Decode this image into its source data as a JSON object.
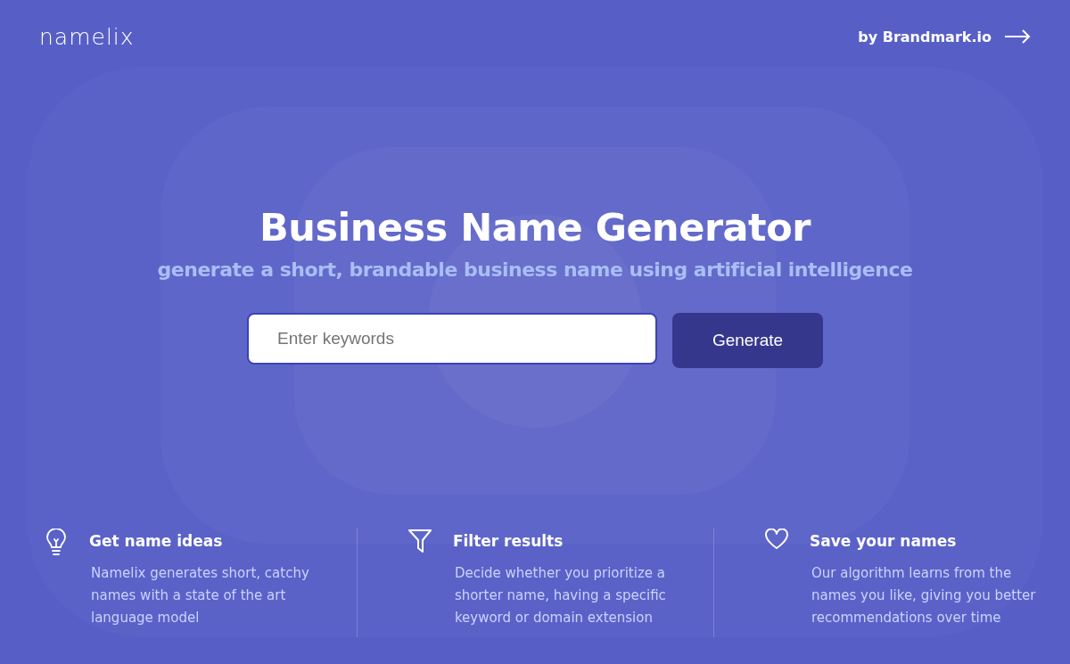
{
  "header": {
    "logo": "namelix",
    "link": "by Brandmark.io"
  },
  "hero": {
    "title": "Business Name Generator",
    "subtitle": "generate a short, brandable business name using artificial intelligence"
  },
  "search": {
    "placeholder": "Enter keywords",
    "button": "Generate"
  },
  "features": [
    {
      "kind": "bulb",
      "title": "Get name ideas",
      "text": "Namelix generates short, catchy names with a state of the art language model"
    },
    {
      "kind": "filter",
      "title": "Filter results",
      "text": "Decide whether you prioritize a shorter name, having a specific keyword or domain extension"
    },
    {
      "kind": "heart",
      "title": "Save your names",
      "text": "Our algorithm learns from the names you like, giving you better recommendations over time"
    }
  ]
}
